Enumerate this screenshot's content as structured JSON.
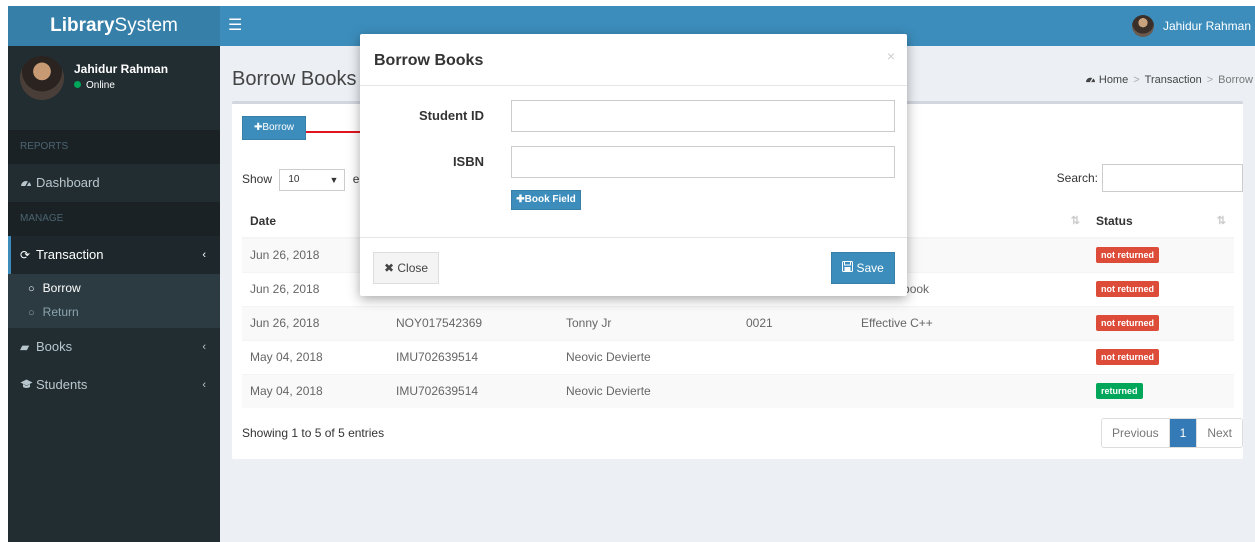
{
  "brand": {
    "bold": "Library",
    "light": "System"
  },
  "header": {
    "toggle_icon": "☰",
    "user_name": "Jahidur Rahman"
  },
  "sidebar": {
    "user": {
      "name": "Jahidur Rahman",
      "status": "Online"
    },
    "sections": {
      "reports": "REPORTS",
      "manage": "MANAGE"
    },
    "items": {
      "dashboard": {
        "label": "Dashboard",
        "icon": "dashboard-icon"
      },
      "transaction": {
        "label": "Transaction",
        "icon": "refresh-icon"
      },
      "borrow": {
        "label": "Borrow"
      },
      "return": {
        "label": "Return"
      },
      "books": {
        "label": "Books",
        "icon": "book-icon"
      },
      "students": {
        "label": "Students",
        "icon": "graduation-cap-icon"
      }
    }
  },
  "page": {
    "title": "Borrow Books",
    "breadcrumb": {
      "home": "Home",
      "transaction": "Transaction",
      "current": "Borrow"
    },
    "borrow_button": "Borrow"
  },
  "table": {
    "show_label": "Show",
    "length_value": "10",
    "entries_label": "en",
    "search_label": "Search:",
    "columns": [
      "Date",
      "",
      "",
      "",
      "",
      "Status"
    ],
    "rows": [
      {
        "date": "Jun 26, 2018",
        "student_id": "",
        "name": "",
        "isbn": "",
        "title": "",
        "status": "not returned",
        "returned": false
      },
      {
        "date": "Jun 26, 2018",
        "student_id": "",
        "name": "",
        "isbn": "",
        "title": "ry Handbook",
        "status": "not returned",
        "returned": false
      },
      {
        "date": "Jun 26, 2018",
        "student_id": "NOY017542369",
        "name": "Tonny Jr",
        "isbn": "0021",
        "title": "Effective C++",
        "status": "not returned",
        "returned": false
      },
      {
        "date": "May 04, 2018",
        "student_id": "IMU702639514",
        "name": "Neovic Devierte",
        "isbn": "",
        "title": "",
        "status": "not returned",
        "returned": false
      },
      {
        "date": "May 04, 2018",
        "student_id": "IMU702639514",
        "name": "Neovic Devierte",
        "isbn": "",
        "title": "",
        "status": "returned",
        "returned": true
      }
    ],
    "info": "Showing 1 to 5 of 5 entries",
    "pagination": {
      "previous": "Previous",
      "current": "1",
      "next": "Next"
    }
  },
  "modal": {
    "title": "Borrow Books",
    "close_x": "×",
    "fields": {
      "student_id": {
        "label": "Student ID",
        "value": ""
      },
      "isbn": {
        "label": "ISBN",
        "value": ""
      }
    },
    "book_field_button": "Book Field",
    "close_button": "Close",
    "save_button": "Save"
  },
  "colors": {
    "primary": "#3c8dbc",
    "sidebar": "#222d32",
    "danger": "#dd4b39",
    "success": "#00a65a"
  }
}
